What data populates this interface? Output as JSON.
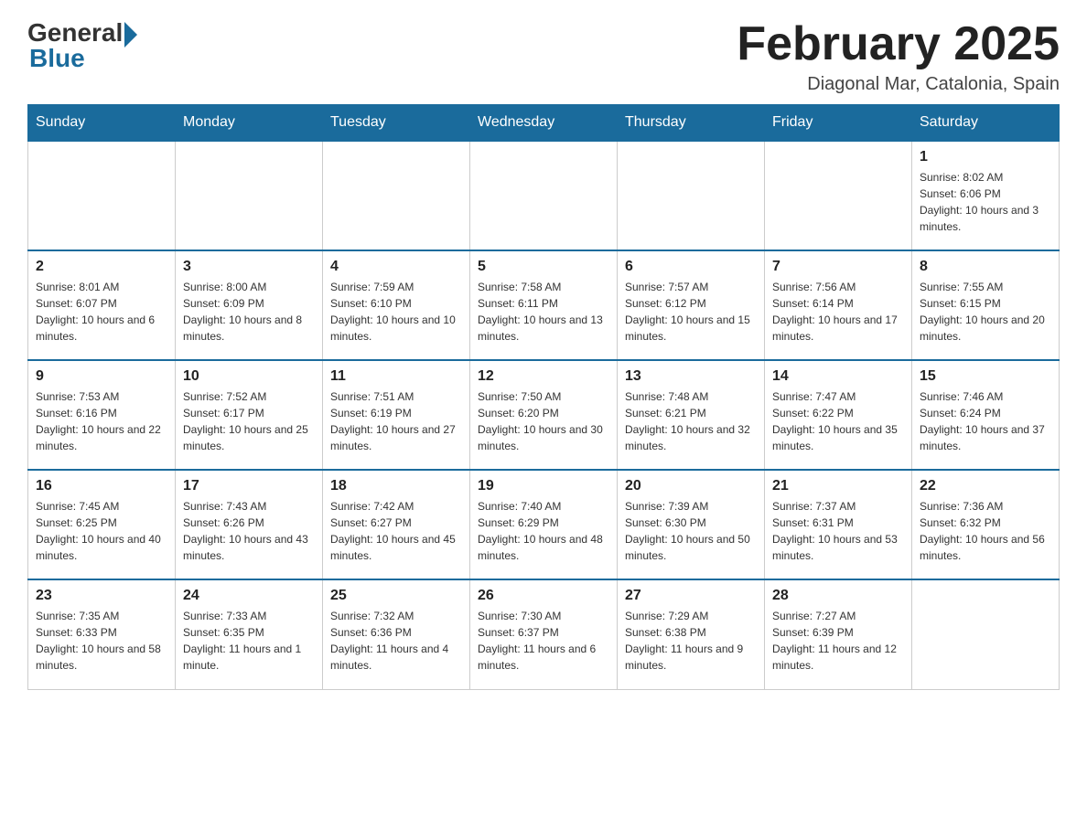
{
  "header": {
    "logo_general": "General",
    "logo_blue": "Blue",
    "month_title": "February 2025",
    "location": "Diagonal Mar, Catalonia, Spain"
  },
  "weekdays": [
    "Sunday",
    "Monday",
    "Tuesday",
    "Wednesday",
    "Thursday",
    "Friday",
    "Saturday"
  ],
  "weeks": [
    [
      null,
      null,
      null,
      null,
      null,
      null,
      {
        "day": "1",
        "sunrise": "Sunrise: 8:02 AM",
        "sunset": "Sunset: 6:06 PM",
        "daylight": "Daylight: 10 hours and 3 minutes."
      }
    ],
    [
      {
        "day": "2",
        "sunrise": "Sunrise: 8:01 AM",
        "sunset": "Sunset: 6:07 PM",
        "daylight": "Daylight: 10 hours and 6 minutes."
      },
      {
        "day": "3",
        "sunrise": "Sunrise: 8:00 AM",
        "sunset": "Sunset: 6:09 PM",
        "daylight": "Daylight: 10 hours and 8 minutes."
      },
      {
        "day": "4",
        "sunrise": "Sunrise: 7:59 AM",
        "sunset": "Sunset: 6:10 PM",
        "daylight": "Daylight: 10 hours and 10 minutes."
      },
      {
        "day": "5",
        "sunrise": "Sunrise: 7:58 AM",
        "sunset": "Sunset: 6:11 PM",
        "daylight": "Daylight: 10 hours and 13 minutes."
      },
      {
        "day": "6",
        "sunrise": "Sunrise: 7:57 AM",
        "sunset": "Sunset: 6:12 PM",
        "daylight": "Daylight: 10 hours and 15 minutes."
      },
      {
        "day": "7",
        "sunrise": "Sunrise: 7:56 AM",
        "sunset": "Sunset: 6:14 PM",
        "daylight": "Daylight: 10 hours and 17 minutes."
      },
      {
        "day": "8",
        "sunrise": "Sunrise: 7:55 AM",
        "sunset": "Sunset: 6:15 PM",
        "daylight": "Daylight: 10 hours and 20 minutes."
      }
    ],
    [
      {
        "day": "9",
        "sunrise": "Sunrise: 7:53 AM",
        "sunset": "Sunset: 6:16 PM",
        "daylight": "Daylight: 10 hours and 22 minutes."
      },
      {
        "day": "10",
        "sunrise": "Sunrise: 7:52 AM",
        "sunset": "Sunset: 6:17 PM",
        "daylight": "Daylight: 10 hours and 25 minutes."
      },
      {
        "day": "11",
        "sunrise": "Sunrise: 7:51 AM",
        "sunset": "Sunset: 6:19 PM",
        "daylight": "Daylight: 10 hours and 27 minutes."
      },
      {
        "day": "12",
        "sunrise": "Sunrise: 7:50 AM",
        "sunset": "Sunset: 6:20 PM",
        "daylight": "Daylight: 10 hours and 30 minutes."
      },
      {
        "day": "13",
        "sunrise": "Sunrise: 7:48 AM",
        "sunset": "Sunset: 6:21 PM",
        "daylight": "Daylight: 10 hours and 32 minutes."
      },
      {
        "day": "14",
        "sunrise": "Sunrise: 7:47 AM",
        "sunset": "Sunset: 6:22 PM",
        "daylight": "Daylight: 10 hours and 35 minutes."
      },
      {
        "day": "15",
        "sunrise": "Sunrise: 7:46 AM",
        "sunset": "Sunset: 6:24 PM",
        "daylight": "Daylight: 10 hours and 37 minutes."
      }
    ],
    [
      {
        "day": "16",
        "sunrise": "Sunrise: 7:45 AM",
        "sunset": "Sunset: 6:25 PM",
        "daylight": "Daylight: 10 hours and 40 minutes."
      },
      {
        "day": "17",
        "sunrise": "Sunrise: 7:43 AM",
        "sunset": "Sunset: 6:26 PM",
        "daylight": "Daylight: 10 hours and 43 minutes."
      },
      {
        "day": "18",
        "sunrise": "Sunrise: 7:42 AM",
        "sunset": "Sunset: 6:27 PM",
        "daylight": "Daylight: 10 hours and 45 minutes."
      },
      {
        "day": "19",
        "sunrise": "Sunrise: 7:40 AM",
        "sunset": "Sunset: 6:29 PM",
        "daylight": "Daylight: 10 hours and 48 minutes."
      },
      {
        "day": "20",
        "sunrise": "Sunrise: 7:39 AM",
        "sunset": "Sunset: 6:30 PM",
        "daylight": "Daylight: 10 hours and 50 minutes."
      },
      {
        "day": "21",
        "sunrise": "Sunrise: 7:37 AM",
        "sunset": "Sunset: 6:31 PM",
        "daylight": "Daylight: 10 hours and 53 minutes."
      },
      {
        "day": "22",
        "sunrise": "Sunrise: 7:36 AM",
        "sunset": "Sunset: 6:32 PM",
        "daylight": "Daylight: 10 hours and 56 minutes."
      }
    ],
    [
      {
        "day": "23",
        "sunrise": "Sunrise: 7:35 AM",
        "sunset": "Sunset: 6:33 PM",
        "daylight": "Daylight: 10 hours and 58 minutes."
      },
      {
        "day": "24",
        "sunrise": "Sunrise: 7:33 AM",
        "sunset": "Sunset: 6:35 PM",
        "daylight": "Daylight: 11 hours and 1 minute."
      },
      {
        "day": "25",
        "sunrise": "Sunrise: 7:32 AM",
        "sunset": "Sunset: 6:36 PM",
        "daylight": "Daylight: 11 hours and 4 minutes."
      },
      {
        "day": "26",
        "sunrise": "Sunrise: 7:30 AM",
        "sunset": "Sunset: 6:37 PM",
        "daylight": "Daylight: 11 hours and 6 minutes."
      },
      {
        "day": "27",
        "sunrise": "Sunrise: 7:29 AM",
        "sunset": "Sunset: 6:38 PM",
        "daylight": "Daylight: 11 hours and 9 minutes."
      },
      {
        "day": "28",
        "sunrise": "Sunrise: 7:27 AM",
        "sunset": "Sunset: 6:39 PM",
        "daylight": "Daylight: 11 hours and 12 minutes."
      },
      null
    ]
  ]
}
